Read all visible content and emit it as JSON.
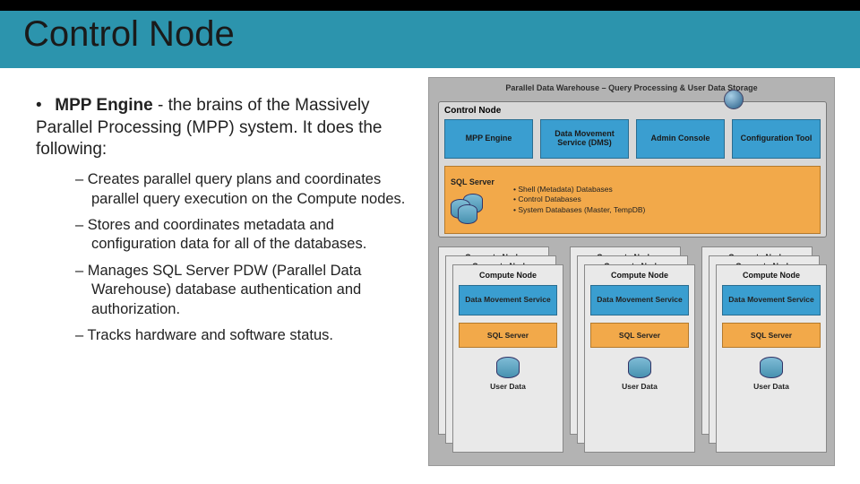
{
  "title": "Control Node",
  "bullet": {
    "bold": "MPP Engine",
    "tail": " - the brains of the Massively Parallel Processing (MPP) system. It does the following:"
  },
  "subs": [
    "Creates parallel query plans and coordinates parallel query execution on the Compute nodes.",
    "Stores and coordinates metadata and configuration data for all of the databases.",
    "Manages SQL Server PDW (Parallel Data Warehouse) database authentication and authorization.",
    "Tracks hardware and software status."
  ],
  "diagram": {
    "pdw_title": "Parallel Data Warehouse – Query Processing & User Data Storage",
    "control": {
      "heading": "Control Node",
      "cells": [
        "MPP Engine",
        "Data Movement Service (DMS)",
        "Admin Console",
        "Configuration Tool"
      ],
      "sql_label": "SQL Server",
      "db_bullets": [
        "Shell (Metadata) Databases",
        "Control Databases",
        "System Databases (Master, TempDB)"
      ]
    },
    "compute": {
      "heading": "Compute Node",
      "dms": "Data Movement Service",
      "sql": "SQL Server",
      "user_data": "User Data"
    }
  }
}
